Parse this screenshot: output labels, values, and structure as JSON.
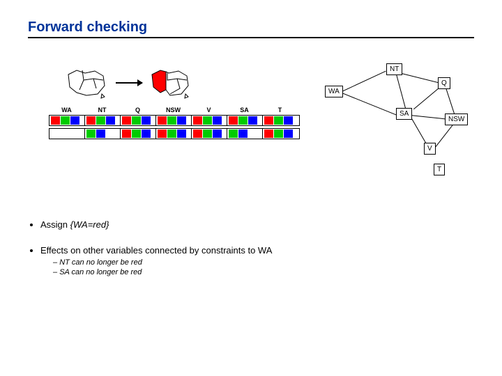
{
  "title": "Forward checking",
  "table": {
    "headers": [
      "WA",
      "NT",
      "Q",
      "NSW",
      "V",
      "SA",
      "T"
    ],
    "row1": {
      "WA": [
        "r",
        "g",
        "b"
      ],
      "NT": [
        "r",
        "g",
        "b"
      ],
      "Q": [
        "r",
        "g",
        "b"
      ],
      "NSW": [
        "r",
        "g",
        "b"
      ],
      "V": [
        "r",
        "g",
        "b"
      ],
      "SA": [
        "r",
        "g",
        "b"
      ],
      "T": [
        "r",
        "g",
        "b"
      ]
    },
    "row2": {
      "WA": [
        "rw"
      ],
      "NT": [
        "g",
        "b"
      ],
      "Q": [
        "r",
        "g",
        "b"
      ],
      "NSW": [
        "r",
        "g",
        "b"
      ],
      "V": [
        "r",
        "g",
        "b"
      ],
      "SA": [
        "g",
        "b"
      ],
      "T": [
        "r",
        "g",
        "b"
      ]
    }
  },
  "graph": {
    "nodes": {
      "NT": "NT",
      "WA": "WA",
      "Q": "Q",
      "SA": "SA",
      "NSW": "NSW",
      "V": "V",
      "T": "T"
    }
  },
  "bullets": {
    "b1_prefix": "Assign ",
    "b1_val": "{WA=red}",
    "b2": "Effects on other variables connected by constraints to WA",
    "s1": "NT can no longer be red",
    "s2": "SA can no longer be red"
  }
}
